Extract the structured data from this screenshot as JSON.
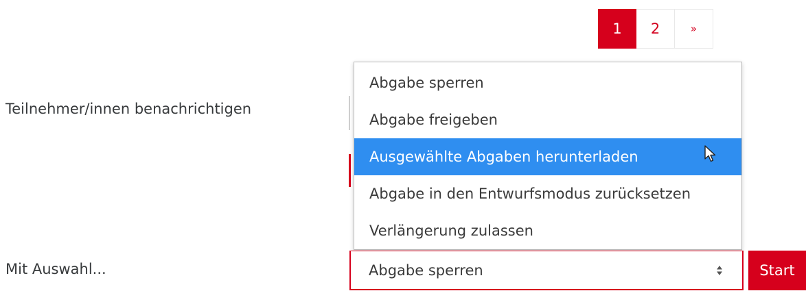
{
  "pagination": {
    "pages": [
      "1",
      "2"
    ],
    "active_page": "1",
    "next_label": "»"
  },
  "form": {
    "notify_label": "Teilnehmer/innen benachrichtigen",
    "selection_label": "Mit Auswahl...",
    "select_value": "Abgabe sperren",
    "start_label": "Start"
  },
  "dropdown": {
    "options": [
      "Abgabe sperren",
      "Abgabe freigeben",
      "Ausgewählte Abgaben herunterladen",
      "Abgabe in den Entwurfsmodus zurücksetzen",
      "Verlängerung zulassen"
    ],
    "highlighted_option": "Ausgewählte Abgaben herunterladen"
  },
  "colors": {
    "accent_red": "#d6001c",
    "highlight_blue": "#2f8ef0"
  },
  "icons": {
    "select_arrow": "sort-arrows-icon",
    "cursor": "mouse-pointer-icon"
  }
}
